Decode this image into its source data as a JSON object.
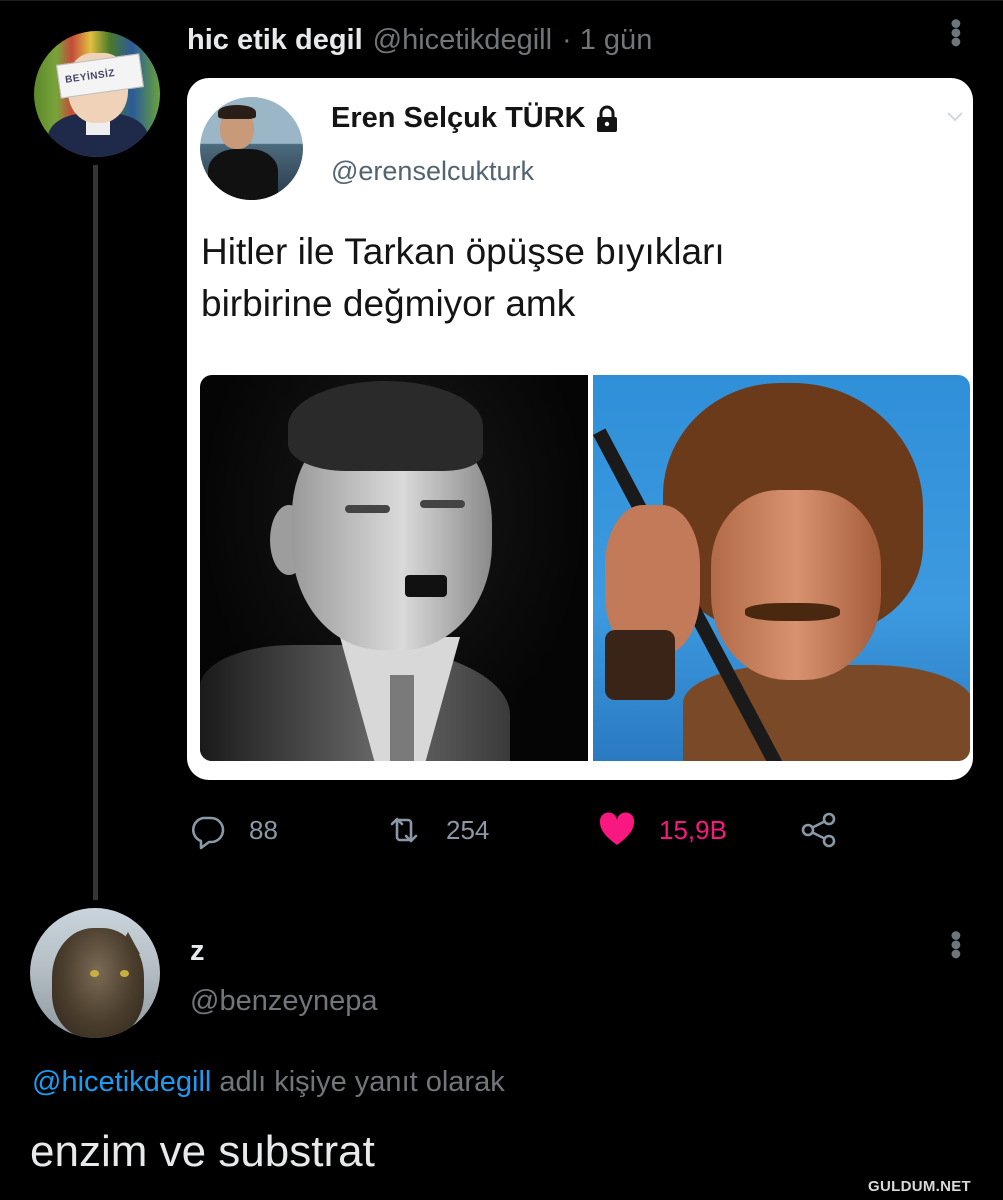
{
  "tweet": {
    "author_name": "hic etik degil",
    "author_handle": "@hicetikdegill",
    "time": "· 1 gün",
    "avatar_sign_text": "BEYİNSİZ",
    "quoted_screenshot": {
      "author_name": "Eren Selçuk TÜRK",
      "author_handle": "@erenselcukturk",
      "text": "Hitler ile Tarkan öpüşse bıyıkları\nbirbirine değmiyor amk"
    },
    "stats": {
      "replies": "88",
      "retweets": "254",
      "likes": "15,9B"
    }
  },
  "reply": {
    "author_name": "z",
    "author_handle": "@benzeynepa",
    "context_mention": "@hicetikdegill",
    "context_suffix": "adlı kişiye yanıt olarak",
    "text": "enzim ve substrat"
  },
  "watermark": "GULDUM.NET",
  "colors": {
    "background": "#000000",
    "like": "#f91880",
    "link": "#1d9bf0",
    "secondary_text": "#71767b"
  }
}
